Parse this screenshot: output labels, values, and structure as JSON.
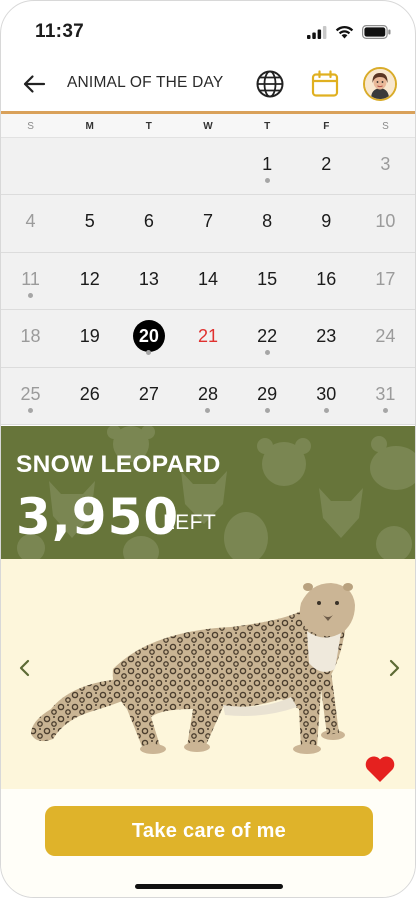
{
  "status_bar": {
    "time": "11:37"
  },
  "header": {
    "title": "ANIMAL OF THE DAY",
    "back_icon": "arrow-left-icon",
    "globe_icon": "globe-icon",
    "calendar_icon": "calendar-icon",
    "accent_color": "#d9a15a"
  },
  "calendar": {
    "weekdays": [
      "S",
      "M",
      "T",
      "W",
      "T",
      "F",
      "S"
    ],
    "weeks": [
      [
        {
          "d": ""
        },
        {
          "d": ""
        },
        {
          "d": ""
        },
        {
          "d": ""
        },
        {
          "d": "1",
          "dot": true
        },
        {
          "d": "2"
        },
        {
          "d": "3"
        }
      ],
      [
        {
          "d": "4"
        },
        {
          "d": "5"
        },
        {
          "d": "6"
        },
        {
          "d": "7"
        },
        {
          "d": "8"
        },
        {
          "d": "9"
        },
        {
          "d": "10"
        }
      ],
      [
        {
          "d": "11",
          "dot": true
        },
        {
          "d": "12"
        },
        {
          "d": "13"
        },
        {
          "d": "14"
        },
        {
          "d": "15"
        },
        {
          "d": "16"
        },
        {
          "d": "17"
        }
      ],
      [
        {
          "d": "18"
        },
        {
          "d": "19"
        },
        {
          "d": "20",
          "dot": true,
          "selected": true
        },
        {
          "d": "21",
          "today": true
        },
        {
          "d": "22",
          "dot": true
        },
        {
          "d": "23"
        },
        {
          "d": "24"
        }
      ],
      [
        {
          "d": "25",
          "dot": true
        },
        {
          "d": "26"
        },
        {
          "d": "27"
        },
        {
          "d": "28",
          "dot": true
        },
        {
          "d": "29",
          "dot": true
        },
        {
          "d": "30",
          "dot": true
        },
        {
          "d": "31",
          "dot": true
        }
      ]
    ],
    "today_color": "#e0312f",
    "selected_color": "#000000"
  },
  "animal": {
    "name": "SNOW LEOPARD",
    "count": "3,950",
    "count_label": "LEFT",
    "banner_color": "#67753a"
  },
  "photo": {
    "prev_icon": "chevron-left-icon",
    "next_icon": "chevron-right-icon",
    "favorite_icon": "heart-icon",
    "heart_color": "#e5211f"
  },
  "cta": {
    "label": "Take care of me",
    "color": "#dfb32a"
  }
}
